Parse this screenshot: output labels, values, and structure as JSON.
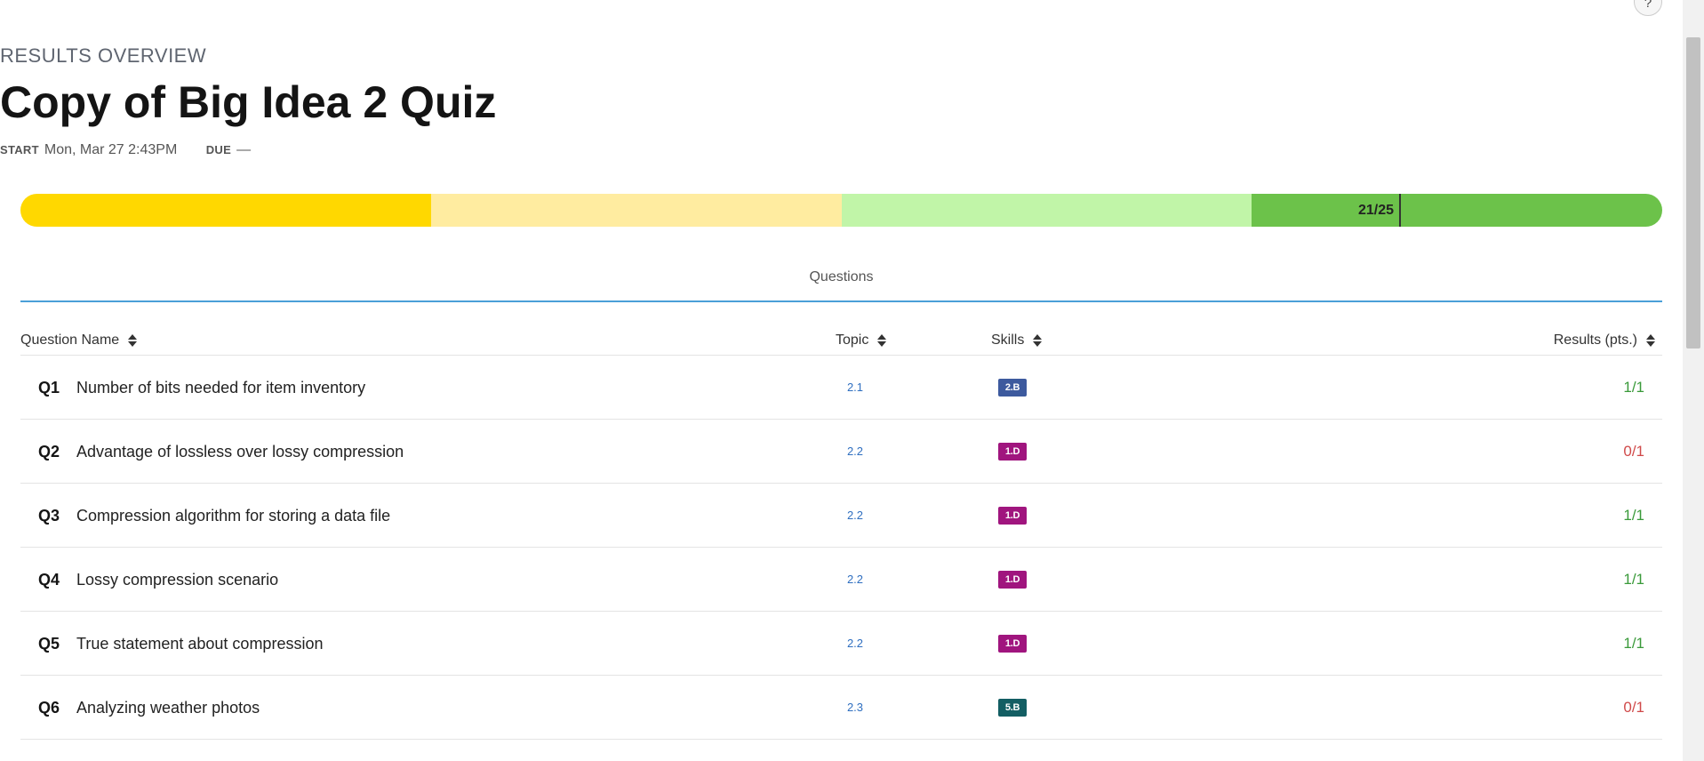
{
  "header": {
    "eyebrow": "RESULTS OVERVIEW",
    "title": "Copy of Big Idea 2 Quiz",
    "start_label": "START",
    "start_value": "Mon, Mar 27 2:43PM",
    "due_label": "DUE",
    "due_value": "—"
  },
  "help": {
    "label": "?"
  },
  "progress": {
    "score_label": "21/25",
    "score_fraction": 0.84,
    "segments": [
      {
        "color": "#ffd800"
      },
      {
        "color": "#ffeca0"
      },
      {
        "color": "#c1f5a8"
      },
      {
        "color": "#6cc24a"
      }
    ]
  },
  "tabs": {
    "questions": "Questions"
  },
  "table": {
    "columns": {
      "name": "Question Name",
      "topic": "Topic",
      "skills": "Skills",
      "results": "Results (pts.)"
    },
    "rows": [
      {
        "num": "Q1",
        "name": "Number of bits needed for item inventory",
        "topic": "2.1",
        "skill": "2.B",
        "skill_color": "#3d5a9e",
        "result": "1/1",
        "result_color": "#3a9a3a"
      },
      {
        "num": "Q2",
        "name": "Advantage of lossless over lossy compression",
        "topic": "2.2",
        "skill": "1.D",
        "skill_color": "#a0157e",
        "result": "0/1",
        "result_color": "#d04a4a"
      },
      {
        "num": "Q3",
        "name": "Compression algorithm for storing a data file",
        "topic": "2.2",
        "skill": "1.D",
        "skill_color": "#a0157e",
        "result": "1/1",
        "result_color": "#3a9a3a"
      },
      {
        "num": "Q4",
        "name": "Lossy compression scenario",
        "topic": "2.2",
        "skill": "1.D",
        "skill_color": "#a0157e",
        "result": "1/1",
        "result_color": "#3a9a3a"
      },
      {
        "num": "Q5",
        "name": "True statement about compression",
        "topic": "2.2",
        "skill": "1.D",
        "skill_color": "#a0157e",
        "result": "1/1",
        "result_color": "#3a9a3a"
      },
      {
        "num": "Q6",
        "name": "Analyzing weather photos",
        "topic": "2.3",
        "skill": "5.B",
        "skill_color": "#135e63",
        "result": "0/1",
        "result_color": "#d04a4a"
      }
    ]
  }
}
